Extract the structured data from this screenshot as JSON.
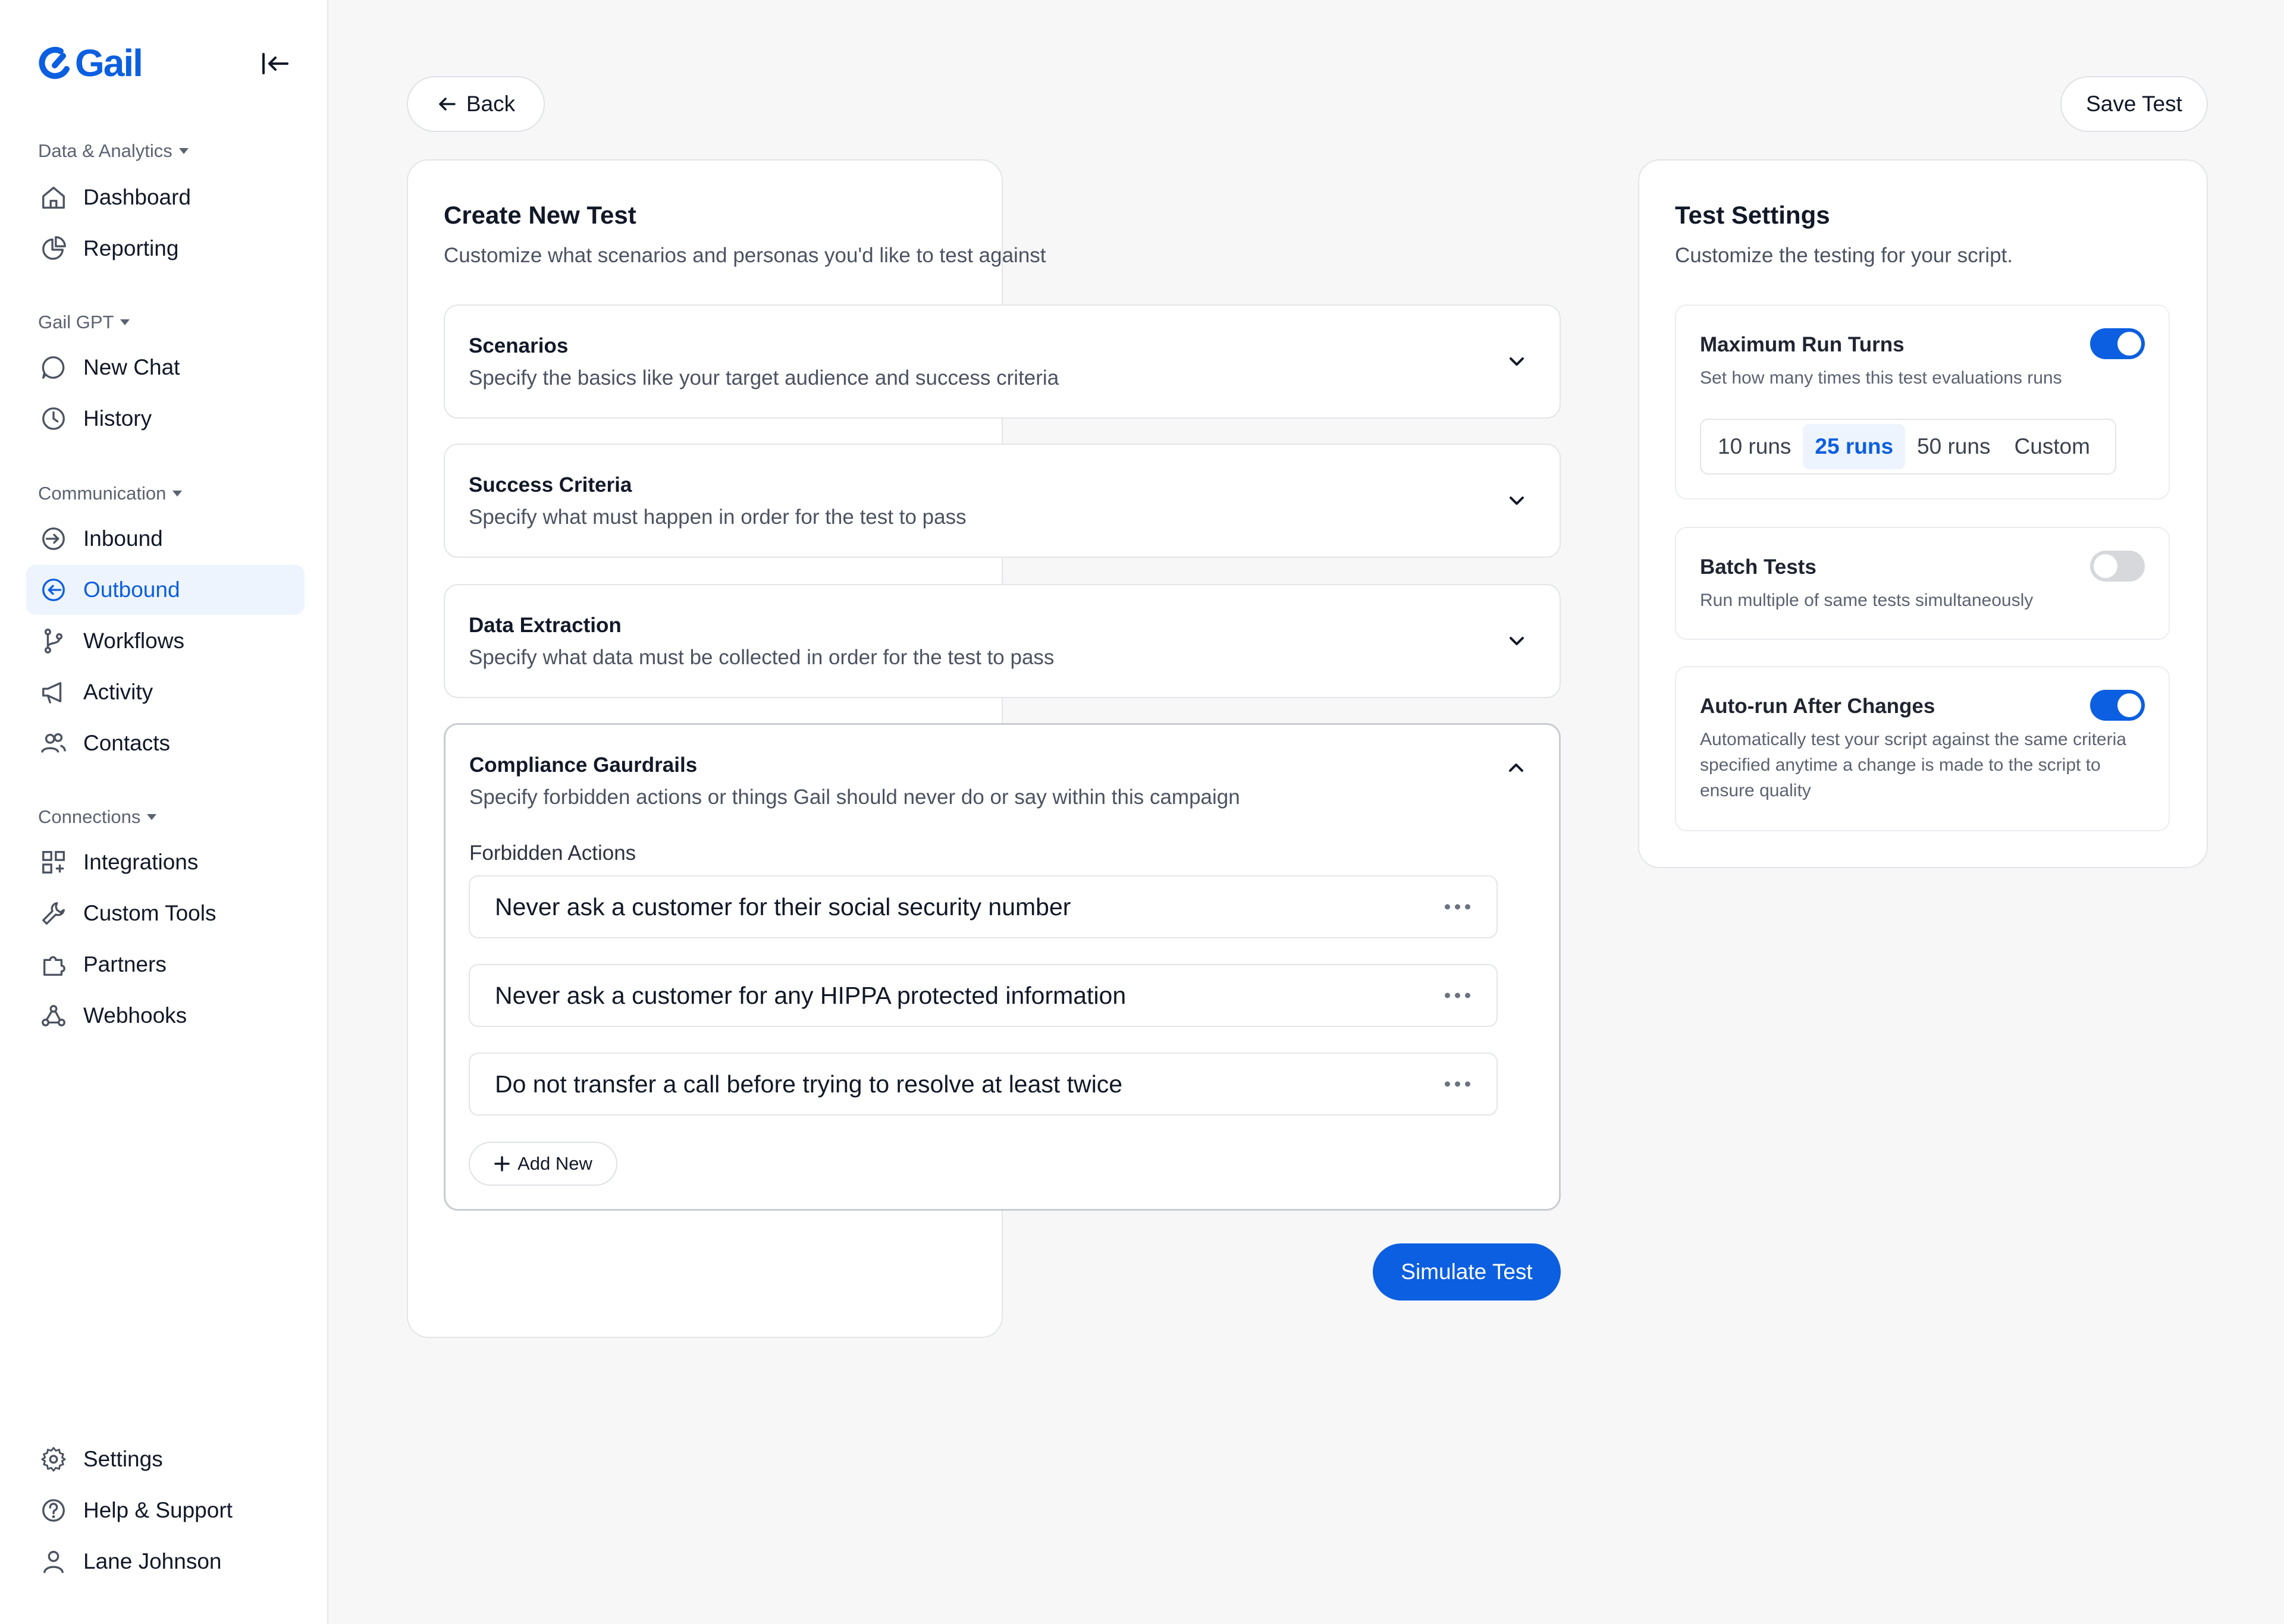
{
  "brand": {
    "name": "Gail",
    "color": "#0b5fe0"
  },
  "sidebar": {
    "sections": [
      {
        "label": "Data & Analytics",
        "items": [
          {
            "label": "Dashboard",
            "icon": "home-icon"
          },
          {
            "label": "Reporting",
            "icon": "pie-chart-icon"
          }
        ]
      },
      {
        "label": "Gail GPT",
        "items": [
          {
            "label": "New Chat",
            "icon": "chat-bubble-icon"
          },
          {
            "label": "History",
            "icon": "clock-icon"
          }
        ]
      },
      {
        "label": "Communication",
        "items": [
          {
            "label": "Inbound",
            "icon": "arrow-in-circle-icon"
          },
          {
            "label": "Outbound",
            "icon": "arrow-out-circle-icon",
            "active": true
          },
          {
            "label": "Workflows",
            "icon": "git-branch-icon"
          },
          {
            "label": "Activity",
            "icon": "megaphone-icon"
          },
          {
            "label": "Contacts",
            "icon": "users-icon"
          }
        ]
      },
      {
        "label": "Connections",
        "items": [
          {
            "label": "Integrations",
            "icon": "grid-plus-icon"
          },
          {
            "label": "Custom Tools",
            "icon": "wrench-icon"
          },
          {
            "label": "Partners",
            "icon": "puzzle-icon"
          },
          {
            "label": "Webhooks",
            "icon": "webhook-icon"
          }
        ]
      }
    ],
    "footer": [
      {
        "label": "Settings",
        "icon": "gear-icon"
      },
      {
        "label": "Help & Support",
        "icon": "question-circle-icon"
      },
      {
        "label": "Lane Johnson",
        "icon": "user-icon"
      }
    ]
  },
  "header": {
    "back_label": "Back",
    "save_label": "Save Test"
  },
  "create": {
    "title": "Create New Test",
    "subtitle": "Customize what scenarios and personas you'd like to test against",
    "accordions": [
      {
        "title": "Scenarios",
        "subtitle": "Specify the basics like your target audience and success criteria",
        "expanded": false
      },
      {
        "title": "Success Criteria",
        "subtitle": "Specify what must happen in order for the test to pass",
        "expanded": false
      },
      {
        "title": "Data Extraction",
        "subtitle": "Specify what data must be collected in order for the test to pass",
        "expanded": false
      },
      {
        "title": "Compliance Gaurdrails",
        "subtitle": "Specify forbidden actions or things Gail should never do or say within this campaign",
        "expanded": true
      }
    ],
    "forbidden_label": "Forbidden Actions",
    "forbidden": [
      "Never ask a customer for their social security number",
      "Never ask a customer for any HIPPA protected information",
      "Do not transfer a call before trying to resolve at least twice"
    ],
    "add_new_label": "Add New",
    "simulate_label": "Simulate Test"
  },
  "settings": {
    "title": "Test Settings",
    "subtitle": "Customize the testing for your script.",
    "max_runs": {
      "title": "Maximum Run Turns",
      "desc": "Set how many times this test evaluations runs",
      "enabled": true,
      "options": [
        "10 runs",
        "25 runs",
        "50 runs",
        "Custom"
      ],
      "selected": "25 runs"
    },
    "batch": {
      "title": "Batch Tests",
      "desc": "Run multiple of same tests simultaneously",
      "enabled": false
    },
    "autorun": {
      "title": "Auto-run After Changes",
      "desc": "Automatically test your script against the same criteria specified anytime a change is made to the script to ensure quality",
      "enabled": true
    }
  }
}
